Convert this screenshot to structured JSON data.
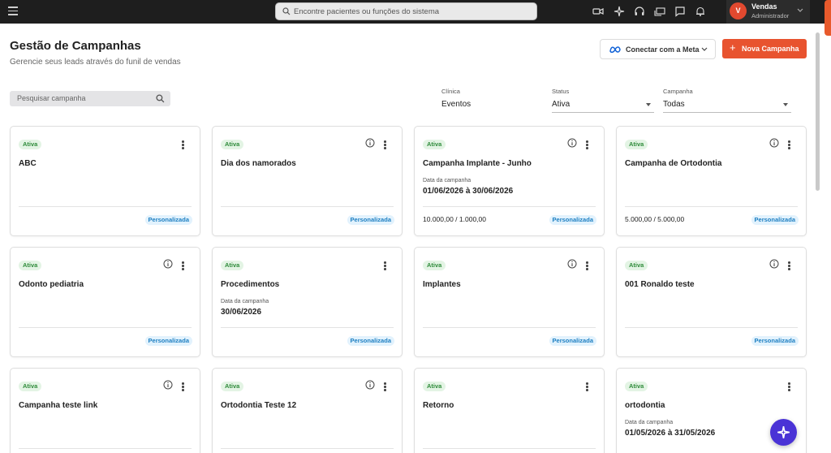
{
  "topbar": {
    "search_placeholder": "Encontre pacientes ou funções do sistema",
    "icons": [
      "video-icon",
      "sparkle-icon",
      "headset-icon",
      "screen-share-icon",
      "chat-icon",
      "bell-icon"
    ],
    "user": {
      "initial": "V",
      "name": "Vendas",
      "role": "Administrador"
    }
  },
  "header": {
    "title": "Gestão de Campanhas",
    "subtitle": "Gerencie seus leads através do funil de vendas",
    "meta_button": "Conectar com a Meta",
    "new_button": "Nova Campanha",
    "new_button_icon": "+"
  },
  "filters": {
    "search_placeholder": "Pesquisar campanha",
    "clinica": {
      "label": "Clínica",
      "value": "Eventos"
    },
    "status": {
      "label": "Status",
      "value": "Ativa"
    },
    "campanha": {
      "label": "Campanha",
      "value": "Todas"
    }
  },
  "cards": [
    {
      "status": "Ativa",
      "title": "ABC",
      "type": "Personalizada"
    },
    {
      "status": "Ativa",
      "title": "Dia dos namorados",
      "type": "Personalizada"
    },
    {
      "status": "Ativa",
      "title": "Campanha Implante - Junho",
      "date_label": "Data da campanha",
      "date": "01/06/2026 à 30/06/2026",
      "amount": "10.000,00 / 1.000,00",
      "type": "Personalizada"
    },
    {
      "status": "Ativa",
      "title": "Campanha de Ortodontia",
      "amount": "5.000,00 / 5.000,00",
      "type": "Personalizada"
    },
    {
      "status": "Ativa",
      "title": "Odonto pediatria",
      "type": "Personalizada"
    },
    {
      "status": "Ativa",
      "title": "Procedimentos",
      "date_label": "Data da campanha",
      "date": "30/06/2026",
      "type": "Personalizada"
    },
    {
      "status": "Ativa",
      "title": "Implantes",
      "type": "Personalizada"
    },
    {
      "status": "Ativa",
      "title": "001 Ronaldo teste",
      "type": "Personalizada"
    },
    {
      "status": "Ativa",
      "title": "Campanha teste link"
    },
    {
      "status": "Ativa",
      "title": "Ortodontia Teste 12"
    },
    {
      "status": "Ativa",
      "title": "Retorno"
    },
    {
      "status": "Ativa",
      "title": "ortodontia",
      "date_label": "Data da campanha",
      "date": "01/05/2026 à 31/05/2026"
    }
  ],
  "colors": {
    "accent": "#e8532f",
    "fab": "#4a33d6",
    "active_badge": "#2e8b3a",
    "custom_badge": "#1d7fc2"
  }
}
